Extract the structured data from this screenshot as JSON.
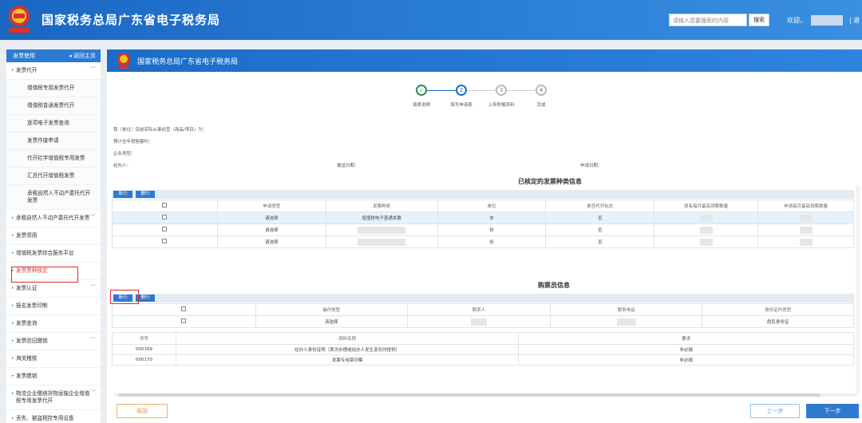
{
  "header": {
    "title": "国家税务总局广东省电子税务局",
    "search_placeholder": "请输入您要搜索的内容",
    "search_label": "搜索",
    "welcome": "欢迎，",
    "logout": "| 退"
  },
  "sidebar": {
    "title": "发票使用",
    "home": "◂ 返回主页",
    "items": [
      {
        "label": "发票代开",
        "chev": "﹀"
      },
      {
        "label": "增值税专用发票代开",
        "sub": true
      },
      {
        "label": "增值税普通发票代开",
        "sub": true
      },
      {
        "label": "逐项电子发票查询",
        "sub": true
      },
      {
        "label": "发票作废申请",
        "sub": true
      },
      {
        "label": "代开红字增值税专用发票",
        "sub": true
      },
      {
        "label": "汇总代开增值税发票",
        "sub": true
      },
      {
        "label": "承租自然人不动产委托代开发票",
        "sub": true
      },
      {
        "label": "承租自然人不动产委托代开发票",
        "chev": "﹀"
      },
      {
        "label": "发票领用"
      },
      {
        "label": "增值税发票综合服务平台"
      },
      {
        "label": "发票票种核定",
        "active": true
      },
      {
        "label": "发票认证",
        "chev": "﹀"
      },
      {
        "label": "报名发票印制"
      },
      {
        "label": "发票查询"
      },
      {
        "label": "发票验旧缴销",
        "chev": "﹀"
      },
      {
        "label": "海关稽核"
      },
      {
        "label": "发票缴销"
      },
      {
        "label": "物流企业缴纳货物运输企业增值税专用发票代开",
        "chev": "﹀"
      },
      {
        "label": "丢失、被盗税控专用设备"
      }
    ]
  },
  "main": {
    "title": "国家税务总局广东省电子税务局",
    "steps": [
      {
        "num": "✓",
        "label": "填表说明"
      },
      {
        "num": "2",
        "label": "填写申请表"
      },
      {
        "num": "3",
        "label": "上传附报资料"
      },
      {
        "num": "4",
        "label": "完成"
      }
    ],
    "info": [
      "我（单位）目前实际从事经营（商品/项目）为：",
      "预计全年销售额约：",
      "企业类型：",
      "经办人：",
      "报送日期：",
      "申请日期："
    ]
  },
  "invoice_section": {
    "title": "已核定的发票种类信息",
    "add": "新行",
    "del": "删行",
    "headers": [
      "",
      "申请类型",
      "发票种类",
      "单位",
      "是否代开标志",
      "原有每月最高领票数量",
      "申请每月最高领票数量"
    ],
    "rows": [
      {
        "type": "请选择",
        "kind": "增值税电子普通发票",
        "unit": "本",
        "flag": "否",
        "sel": true
      },
      {
        "type": "请选择",
        "kind": "",
        "unit": "份",
        "flag": "否"
      },
      {
        "type": "请选择",
        "kind": "",
        "unit": "份",
        "flag": "否"
      }
    ]
  },
  "buyer_section": {
    "title": "购票员信息",
    "add": "新行",
    "del": "删行",
    "headers": [
      "",
      "操作类型",
      "联系人",
      "联系电话",
      "身份证件类型"
    ],
    "rows": [
      {
        "type": "请选择",
        "id_type": "居民身份证"
      }
    ]
  },
  "docs": {
    "headers": [
      "序号",
      "资料名称",
      "要求"
    ],
    "rows": [
      {
        "no": "000169",
        "name": "经办人身份证明（首次办理或经办人发生变化时提供）",
        "req": "非必报"
      },
      {
        "no": "000170",
        "name": "发票专用章印模",
        "req": "非必报"
      }
    ]
  },
  "buttons": {
    "back": "返回",
    "prev": "上一步",
    "next": "下一步"
  },
  "colors": {
    "primary": "#2e7ad1",
    "header": "#1a67c2",
    "highlight": "#e0282e"
  }
}
